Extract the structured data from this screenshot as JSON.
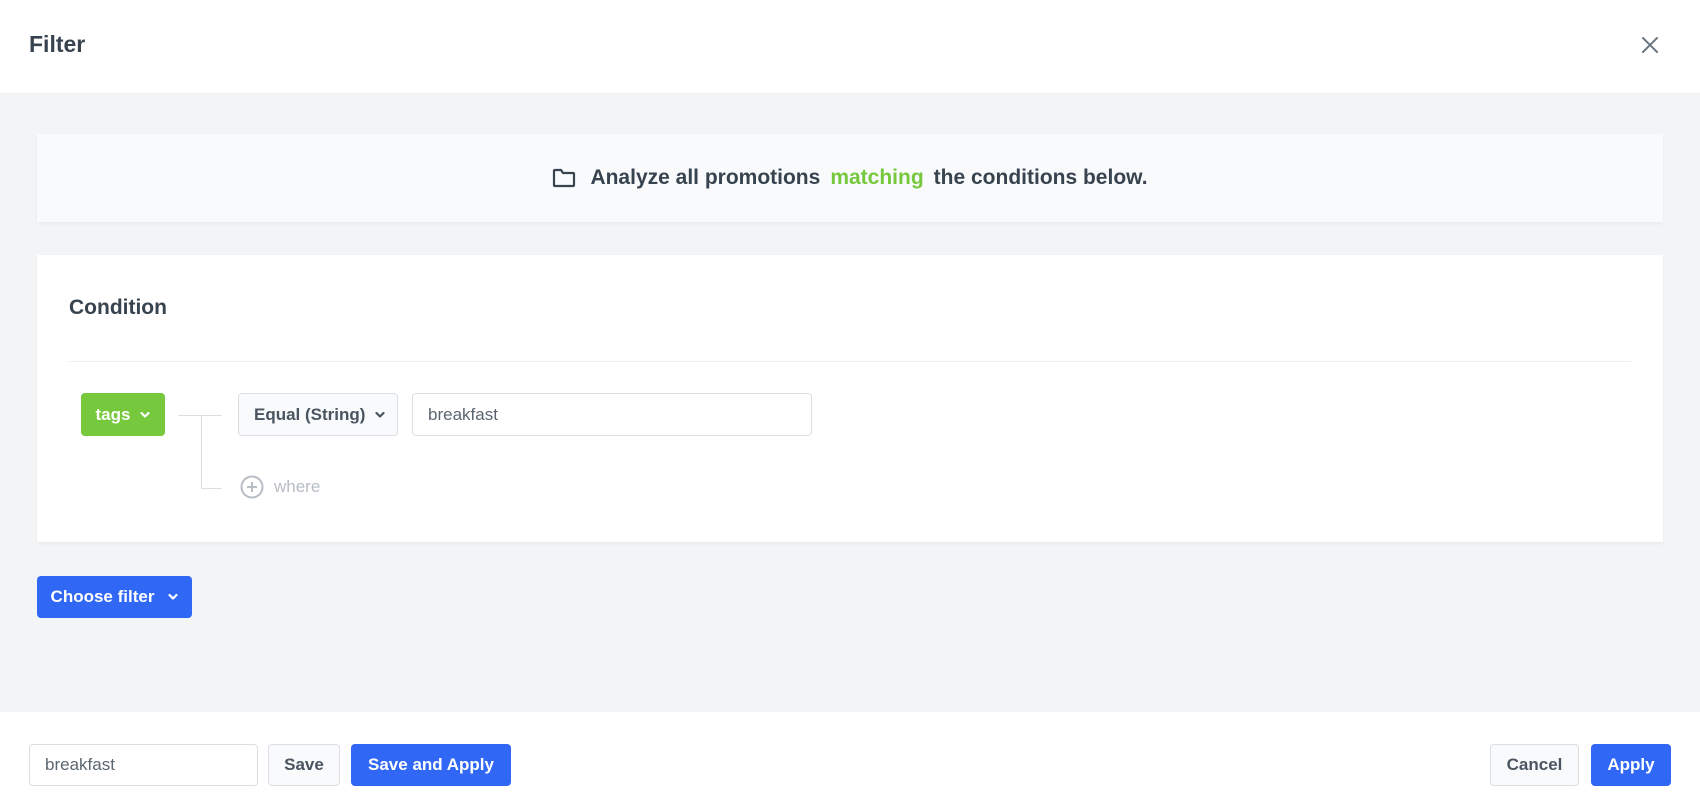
{
  "header": {
    "title": "Filter",
    "close_icon": "close-icon"
  },
  "banner": {
    "icon": "folder-icon",
    "text_before": "Analyze all promotions",
    "highlight": "matching",
    "text_after": "the conditions below.",
    "highlight_color": "#76c83c"
  },
  "condition": {
    "title": "Condition",
    "attribute_label": "tags",
    "operator_label": "Equal (String)",
    "value": "breakfast",
    "where_label": "where"
  },
  "choose_filter_label": "Choose filter",
  "footer": {
    "name_value": "breakfast",
    "save_label": "Save",
    "save_and_apply_label": "Save and Apply",
    "cancel_label": "Cancel",
    "apply_label": "Apply"
  },
  "colors": {
    "primary": "#3068f5",
    "success": "#76c83c",
    "text": "#384350"
  }
}
